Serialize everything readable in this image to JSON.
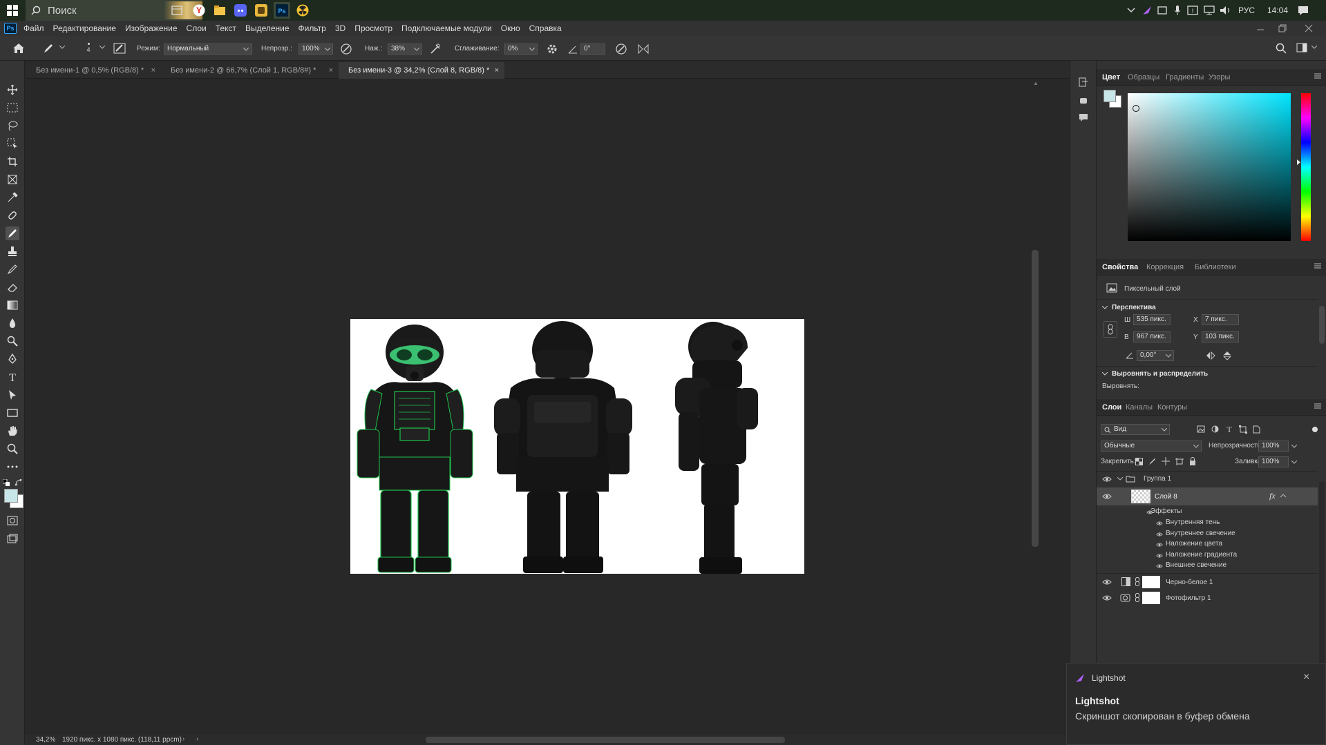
{
  "taskbar": {
    "search_placeholder": "Поиск",
    "lang": "РУС",
    "time": "14:04"
  },
  "menu": [
    "Файл",
    "Редактирование",
    "Изображение",
    "Слои",
    "Текст",
    "Выделение",
    "Фильтр",
    "3D",
    "Просмотр",
    "Подключаемые модули",
    "Окно",
    "Справка"
  ],
  "app_logo": "Ps",
  "options": {
    "brush_size": "4",
    "mode_label": "Режим:",
    "mode_value": "Нормальный",
    "opacity_label": "Непрозр.:",
    "opacity_value": "100%",
    "pressure_label": "Наж.:",
    "pressure_value": "38%",
    "smoothing_label": "Сглаживание:",
    "smoothing_value": "0%",
    "angle_value": "0°"
  },
  "tabs": [
    {
      "label": "Без имени-1 @ 0,5% (RGB/8) *"
    },
    {
      "label": "Без имени-2 @ 66,7% (Слой 1, RGB/8#) *"
    },
    {
      "label": "Без имени-3 @ 34,2% (Слой 8, RGB/8) *"
    }
  ],
  "status": {
    "zoom": "34,2%",
    "doc_info": "1920 пикс. x 1080 пикс. (118,11 ppcm)"
  },
  "color_panel": {
    "tabs": [
      "Цвет",
      "Образцы",
      "Градиенты",
      "Узоры"
    ],
    "hue_color": "#00e5ff",
    "fg_color": "#c8e6e8",
    "bg_color": "#ffffff"
  },
  "properties_panel": {
    "tabs": [
      "Свойства",
      "Коррекция",
      "Библиотеки"
    ],
    "layer_type": "Пиксельный слой",
    "section_transform": "Перспектива",
    "w_label": "Ш",
    "w_value": "535 пикс.",
    "h_label": "В",
    "h_value": "967 пикс.",
    "x_label": "X",
    "x_value": "7 пикс.",
    "y_label": "Y",
    "y_value": "103 пикс.",
    "angle_value": "0,00°",
    "section_align": "Выровнять и распределить",
    "align_label": "Выровнять:"
  },
  "layers_panel": {
    "tabs": [
      "Слои",
      "Каналы",
      "Контуры"
    ],
    "filter_value": "Вид",
    "blend_mode": "Обычные",
    "opacity_label": "Непрозрачность:",
    "opacity_value": "100%",
    "lock_label": "Закрепить:",
    "fill_label": "Заливка:",
    "fill_value": "100%",
    "group_name": "Группа 1",
    "layer_name": "Слой 8",
    "fx_label": "fx",
    "effects_label": "Эффекты",
    "effects": [
      "Внутренняя тень",
      "Внутреннее свечение",
      "Наложение цвета",
      "Наложение градиента",
      "Внешнее свечение"
    ],
    "adjustments": [
      "Черно-белое 1",
      "Фотофильтр 1"
    ]
  },
  "notification": {
    "app": "Lightshot",
    "title": "Lightshot",
    "message": "Скриншот скопирован в буфер обмена"
  }
}
